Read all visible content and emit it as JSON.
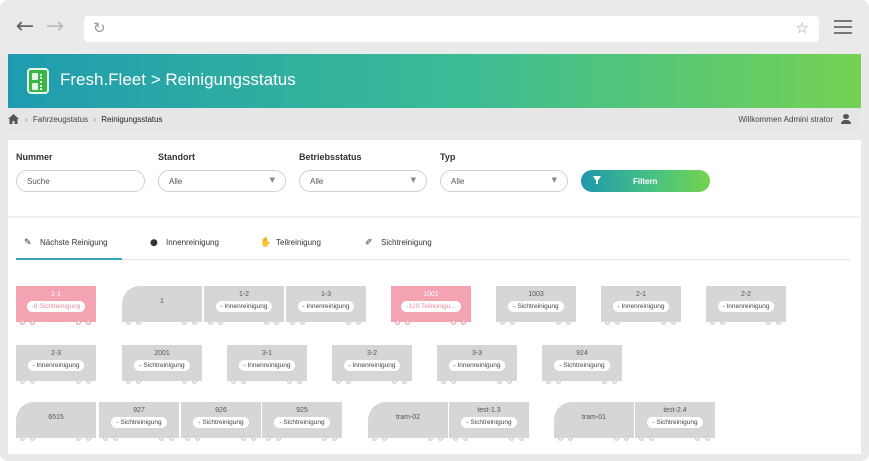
{
  "browser": {
    "url": ""
  },
  "header": {
    "title": "Fresh.Fleet > Reinigungsstatus"
  },
  "breadcrumb": {
    "items": [
      "Fahrzeugstatus",
      "Reinigungsstatus"
    ],
    "separator": "›",
    "welcome": "Willkommen Admini strator"
  },
  "filters": {
    "nummer_label": "Nummer",
    "nummer_placeholder": "Suche",
    "standort_label": "Standort",
    "standort_value": "Alle",
    "betrieb_label": "Betriebsstatus",
    "betrieb_value": "Alle",
    "typ_label": "Typ",
    "typ_value": "Alle",
    "button_label": "Filtern"
  },
  "tabs": [
    {
      "label": "Nächste Reinigung",
      "icon": "wrench-icon",
      "active": true
    },
    {
      "label": "Innenreinigung",
      "icon": "drop-icon",
      "active": false
    },
    {
      "label": "Teilreinigung",
      "icon": "hand-icon",
      "active": false
    },
    {
      "label": "Sichtreinigung",
      "icon": "brush-icon",
      "active": false
    }
  ],
  "vehicles": [
    {
      "name": "1-1",
      "status": "-8 Sichtreinigung",
      "alert": true
    },
    {
      "name": "1",
      "status": "",
      "alert": false
    },
    {
      "name": "1-2",
      "status": "- Innenreinigung",
      "alert": false
    },
    {
      "name": "1-3",
      "status": "- Innenreinigung",
      "alert": false
    },
    {
      "name": "1001",
      "status": "-120 Teilreinigu...",
      "alert": true
    },
    {
      "name": "1003",
      "status": "- Sichtreinigung",
      "alert": false
    },
    {
      "name": "2-1",
      "status": "- Innenreinigung",
      "alert": false
    },
    {
      "name": "2-2",
      "status": "- Innenreinigung",
      "alert": false
    },
    {
      "name": "2-3",
      "status": "- Innenreinigung",
      "alert": false
    },
    {
      "name": "2001",
      "status": "- Sichtreinigung",
      "alert": false
    },
    {
      "name": "3-1",
      "status": "- Innenreinigung",
      "alert": false
    },
    {
      "name": "3-2",
      "status": "- Innenreinigung",
      "alert": false
    },
    {
      "name": "3-3",
      "status": "- Innenreinigung",
      "alert": false
    },
    {
      "name": "924",
      "status": "- Sichtreinigung",
      "alert": false
    },
    {
      "name": "6515",
      "status": "",
      "alert": false
    },
    {
      "name": "927",
      "status": "- Sichtreinigung",
      "alert": false
    },
    {
      "name": "926",
      "status": "- Sichtreinigung",
      "alert": false
    },
    {
      "name": "925",
      "status": "- Sichtreinigung",
      "alert": false
    },
    {
      "name": "tram-02",
      "status": "",
      "alert": false
    },
    {
      "name": "test-1.3",
      "status": "- Sichtreinigung",
      "alert": false
    },
    {
      "name": "tram-01",
      "status": "",
      "alert": false
    },
    {
      "name": "test-2.4",
      "status": "- Sichtreinigung",
      "alert": false
    }
  ]
}
